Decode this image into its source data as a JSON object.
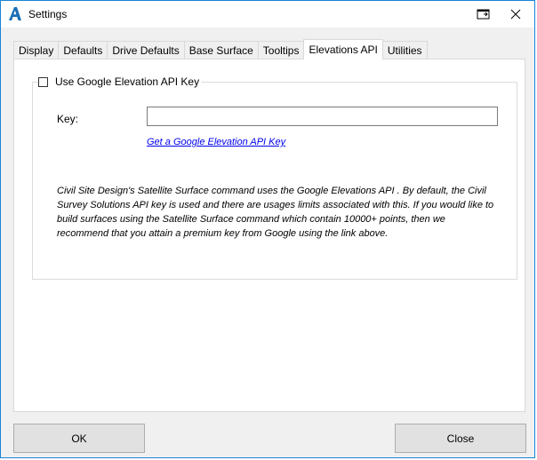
{
  "window": {
    "title": "Settings",
    "app_icon": "autocad-a-icon",
    "accent_color": "#1883d7"
  },
  "tabs": [
    {
      "label": "Display",
      "active": false
    },
    {
      "label": "Defaults",
      "active": false
    },
    {
      "label": "Drive Defaults",
      "active": false
    },
    {
      "label": "Base Surface",
      "active": false
    },
    {
      "label": "Tooltips",
      "active": false
    },
    {
      "label": "Elevations API",
      "active": true
    },
    {
      "label": "Utilities",
      "active": false
    }
  ],
  "elevations_api": {
    "use_key_label": "Use Google Elevation API Key",
    "use_key_checked": false,
    "key_label": "Key:",
    "key_value": "",
    "link_text": "Get a Google Elevation API Key",
    "info_text": "Civil Site Design's Satellite Surface command uses the Google Elevations API . By default, the Civil Survey Solutions API key is used and there are usages limits associated with this. If you would like to build surfaces using the Satellite Surface command which contain 10000+ points, then we recommend that you attain a premium key from Google using the link above."
  },
  "footer": {
    "ok_label": "OK",
    "close_label": "Close"
  }
}
